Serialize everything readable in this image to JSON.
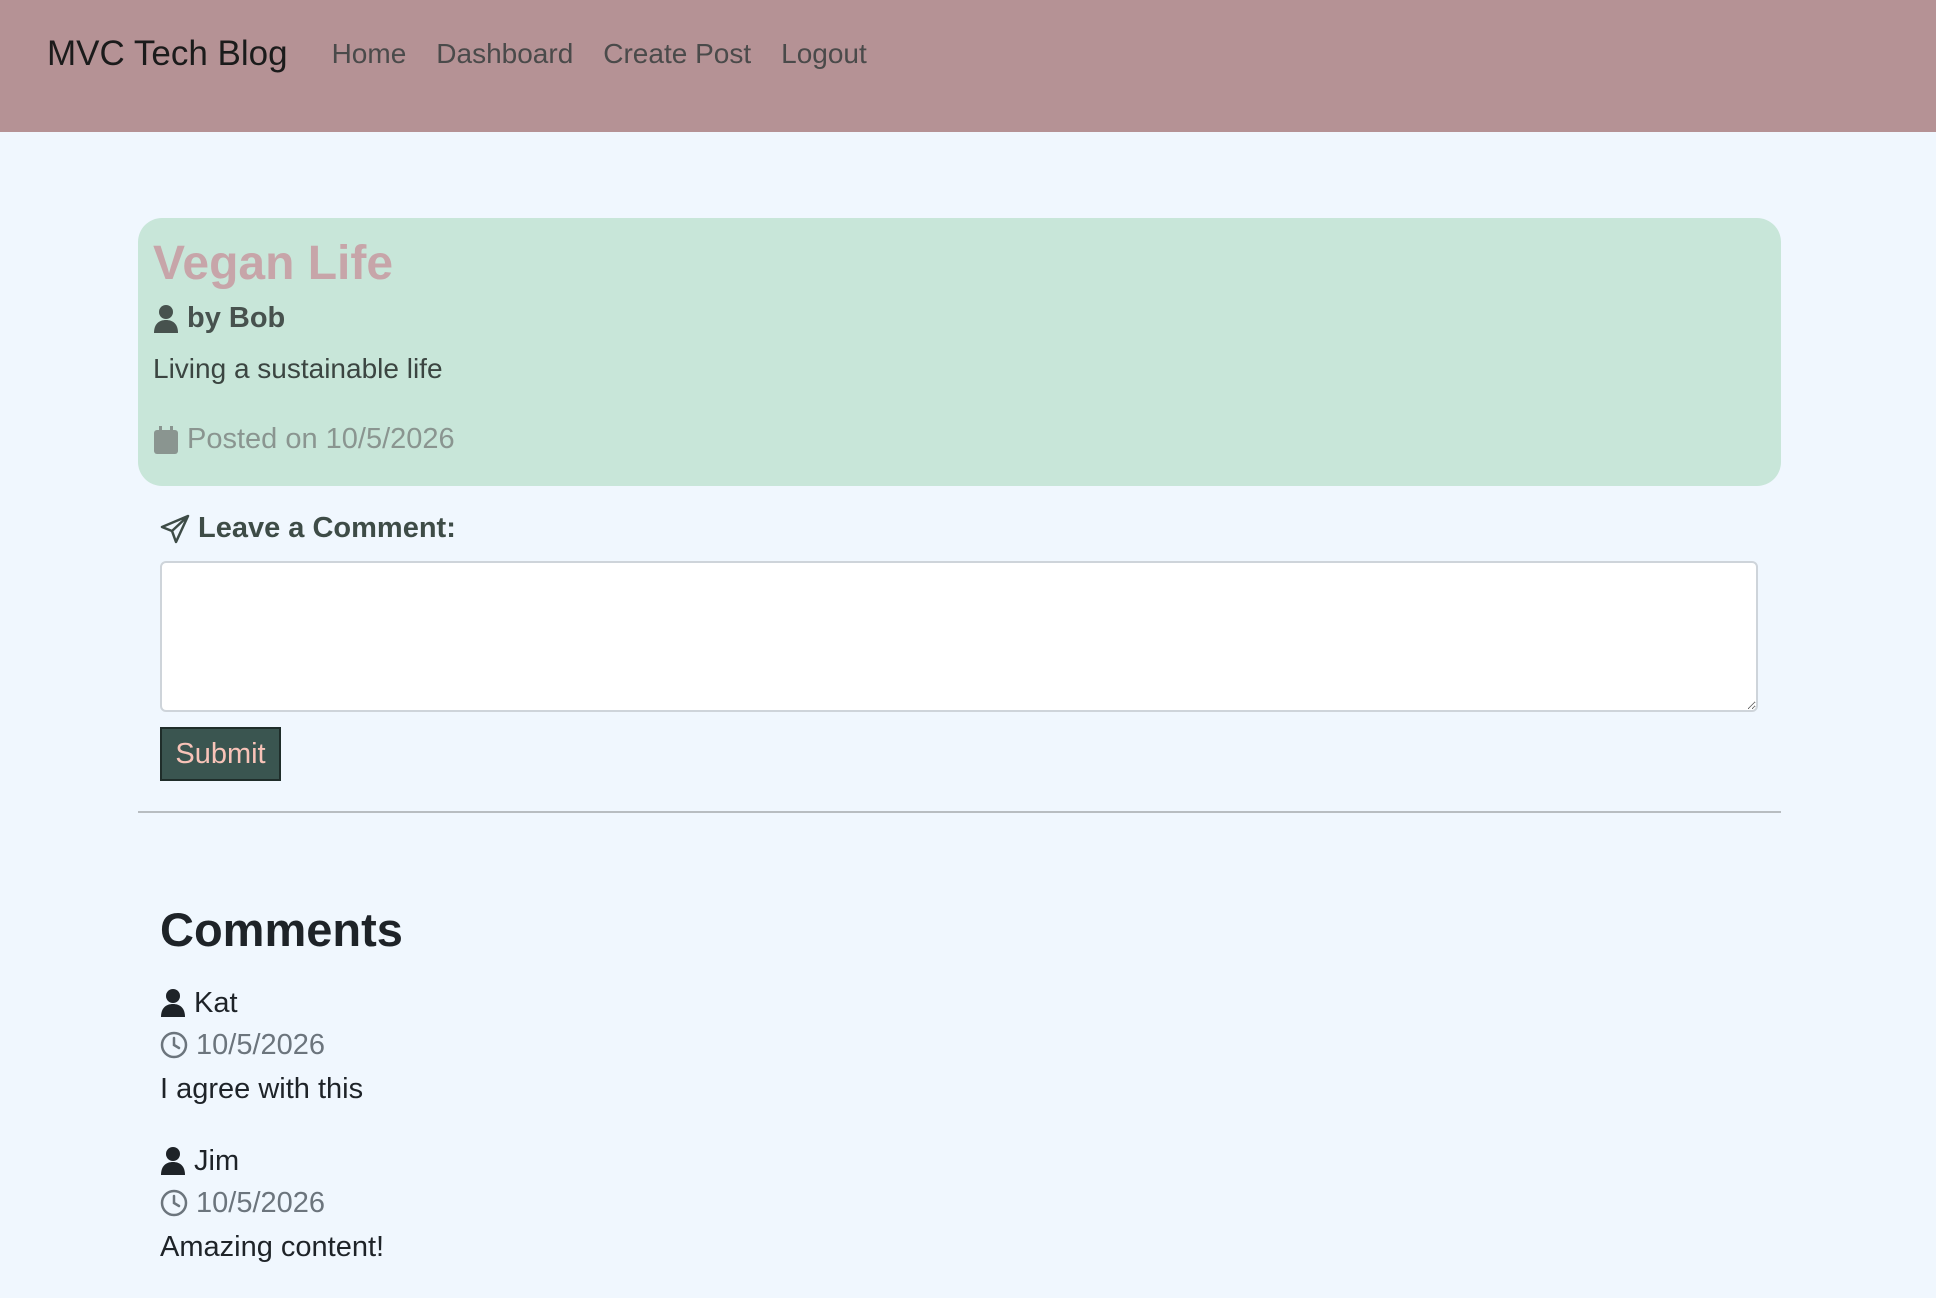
{
  "nav": {
    "brand": "MVC Tech Blog",
    "links": [
      {
        "label": "Home"
      },
      {
        "label": "Dashboard"
      },
      {
        "label": "Create Post"
      },
      {
        "label": "Logout"
      }
    ]
  },
  "post": {
    "title": "Vegan Life",
    "author": "by Bob",
    "body": "Living a sustainable life",
    "date": "Posted on 10/5/2026",
    "author_icon": "user-icon",
    "date_icon": "calendar-icon"
  },
  "comment_form": {
    "label": "Leave a Comment:",
    "label_icon": "paper-plane-icon",
    "textarea_value": "",
    "submit_label": "Submit"
  },
  "comments": {
    "heading": "Comments",
    "items": [
      {
        "user": "Kat",
        "date": "10/5/2026",
        "text": "I agree with this"
      },
      {
        "user": "Jim",
        "date": "10/5/2026",
        "text": "Amazing content!"
      }
    ]
  },
  "colors": {
    "navbar": "#b59295",
    "page_bg": "#f0f7fe",
    "post_card": "#c8e6d9",
    "post_title": "#c7a5a9",
    "submit_bg": "#3a5550",
    "submit_text": "#f8c3b8"
  }
}
